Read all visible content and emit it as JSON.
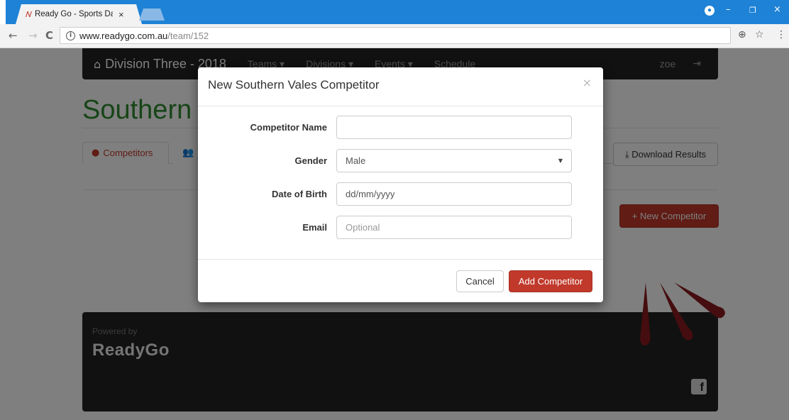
{
  "browser": {
    "tab_title": "Ready Go - Sports Day M",
    "tab_favicon": "readygo-favicon",
    "tab_close": "×",
    "url_host": "www.readygo.com.au",
    "url_path": "/team/152",
    "nav_back": "←",
    "nav_forward": "→",
    "nav_reload": "C",
    "info_glyph": "i",
    "zoom_glyph": "⊕",
    "star_glyph": "☆",
    "menu_glyph": "⋮",
    "profile_glyph": "●",
    "minimize_glyph": "–",
    "restore_glyph": "❐",
    "close_glyph": "×"
  },
  "navbar": {
    "home_glyph": "⌂",
    "brand": "Division Three - 2018",
    "links": [
      "Teams ▾",
      "Divisions ▾",
      "Events ▾",
      "Schedule"
    ],
    "user": "zoe",
    "logout_glyph": "⇥"
  },
  "page": {
    "team_title": "Southern Vales",
    "tab_competitors": "Competitors",
    "tab_team_glyph": "👥",
    "download_button": "⤓ Download Results",
    "new_competitor_button": "+ New Competitor"
  },
  "footer": {
    "powered_by": "Powered by",
    "logo": "ReadyGo",
    "facebook": "f"
  },
  "modal": {
    "title": "New Southern Vales Competitor",
    "close": "×",
    "fields": {
      "name_label": "Competitor Name",
      "name_value": "",
      "gender_label": "Gender",
      "gender_value": "Male",
      "dob_label": "Date of Birth",
      "dob_value": "dd/mm/yyyy",
      "email_label": "Email",
      "email_placeholder": "Optional"
    },
    "cancel_button": "Cancel",
    "add_button": "Add Competitor"
  },
  "colors": {
    "accent": "#c0392b",
    "team_green": "#2e8b2e",
    "chrome_blue": "#1e82d6"
  }
}
